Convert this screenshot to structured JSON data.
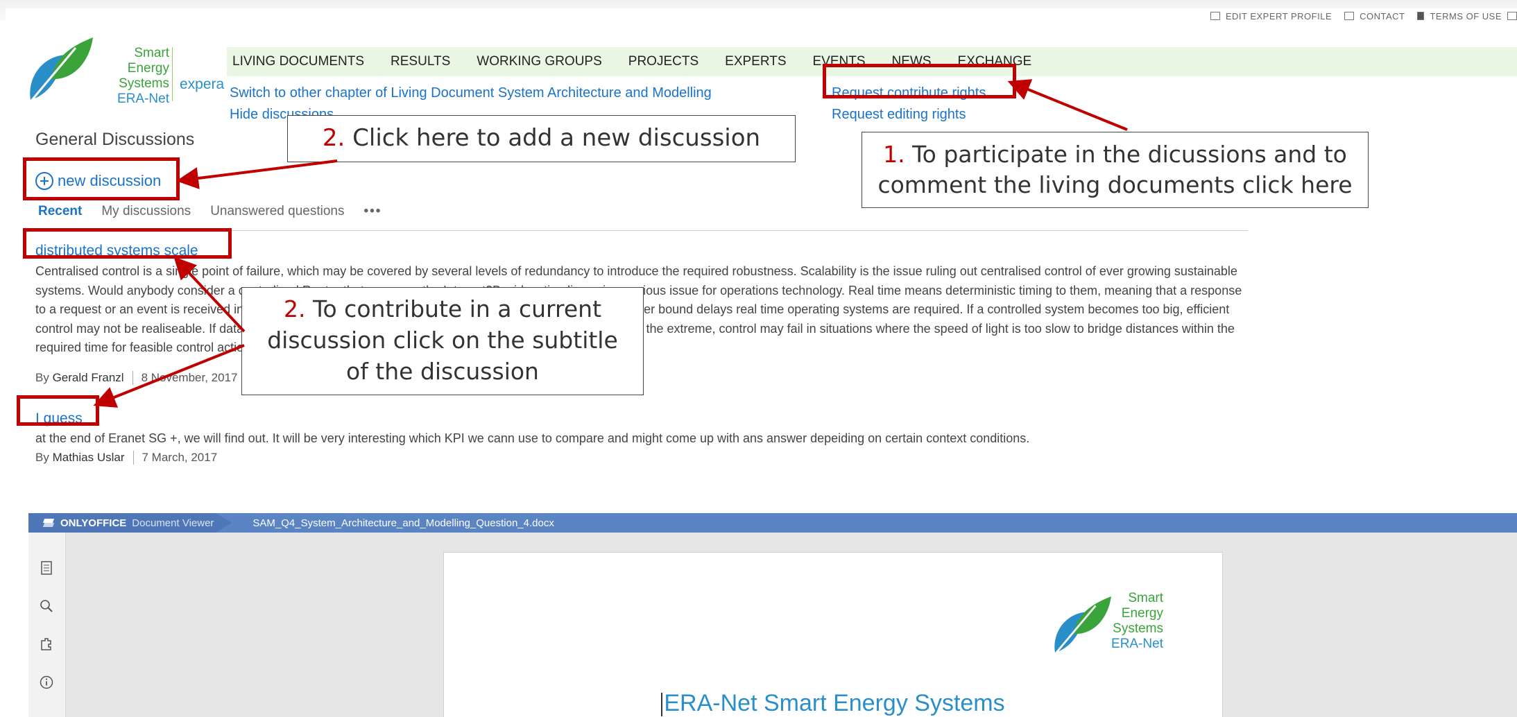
{
  "header": {
    "top_links": [
      "EDIT EXPERT PROFILE",
      "CONTACT",
      "TERMS OF USE"
    ],
    "logo": {
      "lines": [
        "Smart",
        "Energy",
        "Systems",
        "ERA-Net"
      ],
      "suffix": "expera"
    },
    "nav": [
      "LIVING DOCUMENTS",
      "RESULTS",
      "WORKING GROUPS",
      "PROJECTS",
      "EXPERTS",
      "EVENTS",
      "NEWS",
      "EXCHANGE"
    ],
    "switch_chapter": "Switch to other chapter of Living Document System Architecture and Modelling",
    "hide_discussions": "Hide discussions",
    "request_contribute": "Request contribute rights",
    "request_editing": "Request editing rights"
  },
  "discussions": {
    "title": "General Discussions",
    "new_discussion": "new discussion",
    "tabs": [
      "Recent",
      "My discussions",
      "Unanswered questions"
    ],
    "more": "•••",
    "items": [
      {
        "title": "distributed systems scale",
        "body": "Centralised control is a single point of failure, which may be covered by several levels of redundancy to introduce the required robustness. Scalability is the issue ruling out centralised control of ever growing sustainable systems. Would anybody consider a centralised Router that manages the Internet?Besides, timeliness is a serious issue for operations technology. Real time means deterministic timing to them, meaning that a response to a request or an event is received in a precisely defined amount of time. To achieve deterministic, strictly upper bound delays real time operating systems are required. If a controlled system becomes too big, efficient control may not be realiseable. If data volumes accumulate, processing becomes the preventing bottleneck. In the extreme, control may fail in situations where the speed of light is too slow to bridge distances within the required time for feasible control actions, and please note that...",
        "by": "By",
        "author": "Gerald Franzl",
        "date": "8 November, 2017"
      },
      {
        "title": "I guess",
        "body": "at the end of Eranet SG +, we will find out. It will be very interesting which KPI we cann use to compare and might come up with ans answer depeiding on certain context conditions.",
        "by": "By",
        "author": "Mathias Uslar",
        "date": "7 March, 2017"
      }
    ]
  },
  "annotations": {
    "a1": {
      "num": "1.",
      "text": " To participate in the dicussions and to comment the living documents click here"
    },
    "a2_new": {
      "num": "2.",
      "text": " Click here to add a new discussion"
    },
    "a2_current": {
      "num": "2.",
      "text": " To contribute in a current discussion click on the subtitle of the discussion"
    }
  },
  "viewer": {
    "brand_bold": "ONLYOFFICE",
    "brand_label": "Document Viewer",
    "filename": "SAM_Q4_System_Architecture_and_Modelling_Question_4.docx",
    "doc_logo": [
      "Smart",
      "Energy",
      "Systems",
      "ERA-Net"
    ],
    "doc_title": "ERA-Net Smart Energy Systems"
  },
  "colors": {
    "link": "#1a73c8",
    "nav_bg": "#e9f6e4",
    "highlight": "#c00000",
    "viewer_bar": "#5b84c4"
  }
}
